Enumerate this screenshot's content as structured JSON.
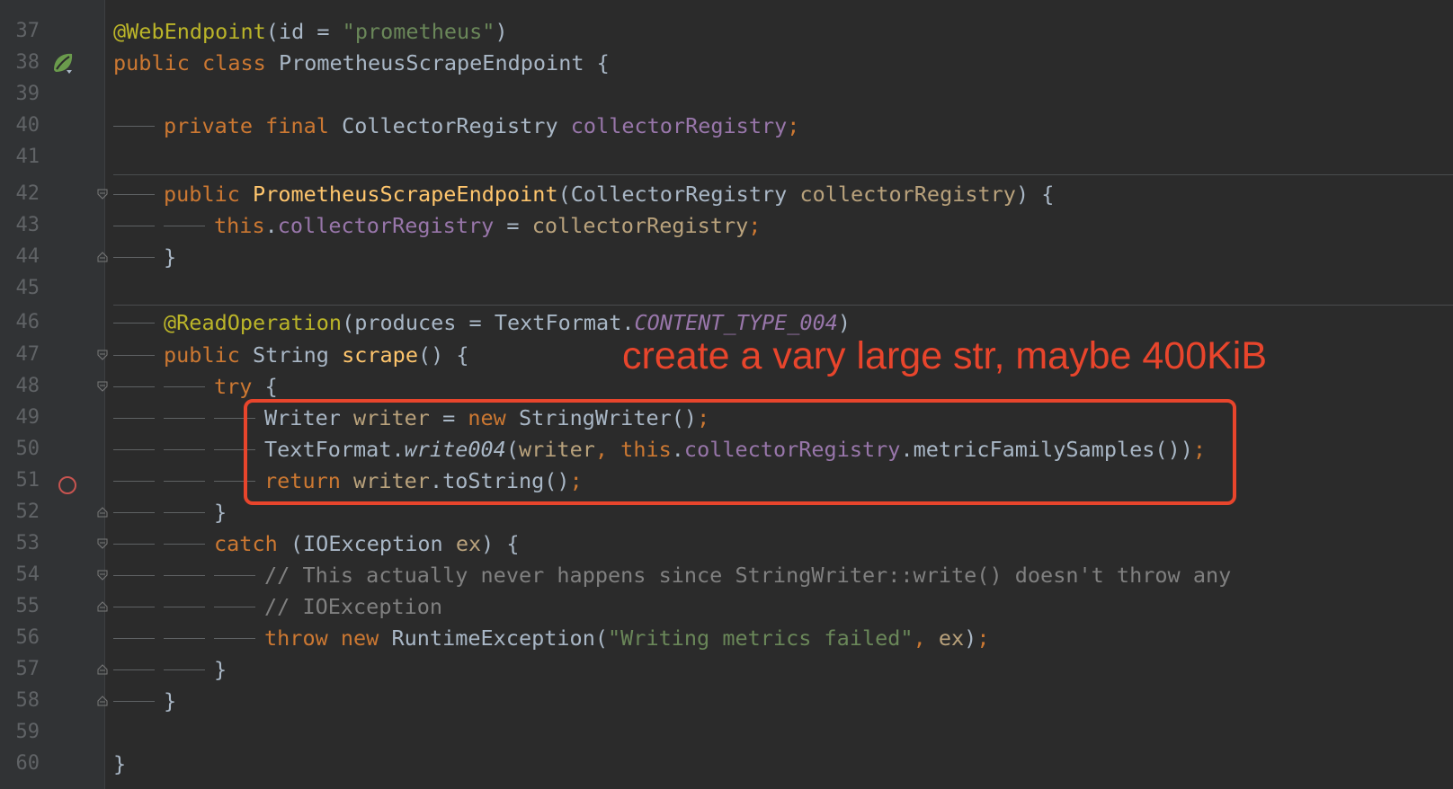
{
  "gutter": {
    "line_numbers": [
      "37",
      "38",
      "39",
      "40",
      "41",
      "42",
      "43",
      "44",
      "45",
      "46",
      "47",
      "48",
      "49",
      "50",
      "51",
      "52",
      "53",
      "54",
      "55",
      "56",
      "57",
      "58",
      "59",
      "60"
    ]
  },
  "code": {
    "l37": {
      "ann": "@WebEndpoint",
      "rest1": "(id = ",
      "str": "\"prometheus\"",
      "rest2": ")"
    },
    "l38": {
      "kw": "public class ",
      "name": "PrometheusScrapeEndpoint {"
    },
    "l40": {
      "kw": "private final ",
      "type": "CollectorRegistry ",
      "field": "collectorRegistry",
      "end": ";"
    },
    "l42": {
      "kw": "public ",
      "fn": "PrometheusScrapeEndpoint",
      "p1": "(CollectorRegistry ",
      "param": "collectorRegistry",
      "p2": ") {"
    },
    "l43": {
      "kw": "this",
      "dot": ".",
      "field": "collectorRegistry",
      "eq": " = ",
      "param": "collectorRegistry",
      "end": ";"
    },
    "l44": {
      "text": "}"
    },
    "l46": {
      "ann": "@ReadOperation",
      "p1": "(produces = TextFormat.",
      "field": "CONTENT_TYPE_004",
      "p2": ")"
    },
    "l47": {
      "kw": "public ",
      "type": "String ",
      "fn": "scrape",
      "p": "() {"
    },
    "l48": {
      "kw": "try ",
      "p": "{"
    },
    "l49": {
      "type": "Writer ",
      "var": "writer",
      "eq": " = ",
      "kw": "new ",
      "ctor": "StringWriter()",
      "end": ";"
    },
    "l50": {
      "p1": "TextFormat.",
      "method": "write004",
      "p2": "(",
      "var": "writer",
      "comma": ", ",
      "kw": "this",
      "dot": ".",
      "field": "collectorRegistry",
      "p3": ".metricFamilySamples())",
      "end": ";"
    },
    "l51": {
      "kw": "return ",
      "var": "writer",
      "p": ".toString()",
      "end": ";"
    },
    "l52": {
      "text": "}"
    },
    "l53": {
      "kw": "catch ",
      "p1": "(IOException ",
      "var": "ex",
      "p2": ") {"
    },
    "l54": {
      "cm": "// This actually never happens since StringWriter::write() doesn't throw any"
    },
    "l55": {
      "cm": "// IOException"
    },
    "l56": {
      "kw": "throw new ",
      "ctor": "RuntimeException(",
      "str": "\"Writing metrics failed\"",
      "comma": ", ",
      "var": "ex",
      "p": ")",
      "end": ";"
    },
    "l57": {
      "text": "}"
    },
    "l58": {
      "text": "}"
    },
    "l60": {
      "text": "}"
    }
  },
  "annotation": {
    "text": "create a vary large str, maybe 400KiB",
    "color": "#e8452c"
  },
  "icons": {
    "spring": "spring-bean-icon",
    "breakpoint": "breakpoint-icon"
  }
}
